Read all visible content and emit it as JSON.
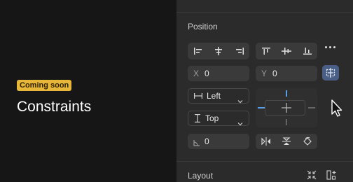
{
  "feature": {
    "badge": "Coming soon",
    "title": "Constraints"
  },
  "position": {
    "label": "Position",
    "align_horizontal": [
      "align-left-icon",
      "align-center-horizontal-icon",
      "align-right-icon"
    ],
    "align_vertical": [
      "align-top-icon",
      "align-center-vertical-icon",
      "align-bottom-icon"
    ],
    "x_label": "X",
    "x_value": "0",
    "y_label": "Y",
    "y_value": "0",
    "horizontal_constraint": "Left",
    "vertical_constraint": "Top",
    "rotation_value": "0",
    "accent_color": "#5aa0e8"
  },
  "layout": {
    "label": "Layout"
  },
  "colors": {
    "badge": "#e7b73a",
    "panel": "#2b2b2b",
    "canvas": "#161616",
    "active_toggle": "#4a5f86"
  }
}
